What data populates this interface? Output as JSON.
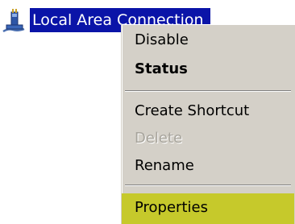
{
  "desktop_item": {
    "icon": "network-connection-icon",
    "label": "Local Area Connection"
  },
  "context_menu": {
    "items": [
      {
        "label": "Disable",
        "state": "enabled"
      },
      {
        "label": "Status",
        "state": "default-bold"
      },
      {
        "label": "Create Shortcut",
        "state": "enabled"
      },
      {
        "label": "Delete",
        "state": "disabled"
      },
      {
        "label": "Rename",
        "state": "enabled"
      },
      {
        "label": "Properties",
        "state": "highlighted"
      }
    ]
  },
  "colors": {
    "selection_blue": "#0a14a8",
    "menu_background": "#d4d0c8",
    "highlight": "#c6c92b",
    "disabled_text": "#a7a49c"
  }
}
